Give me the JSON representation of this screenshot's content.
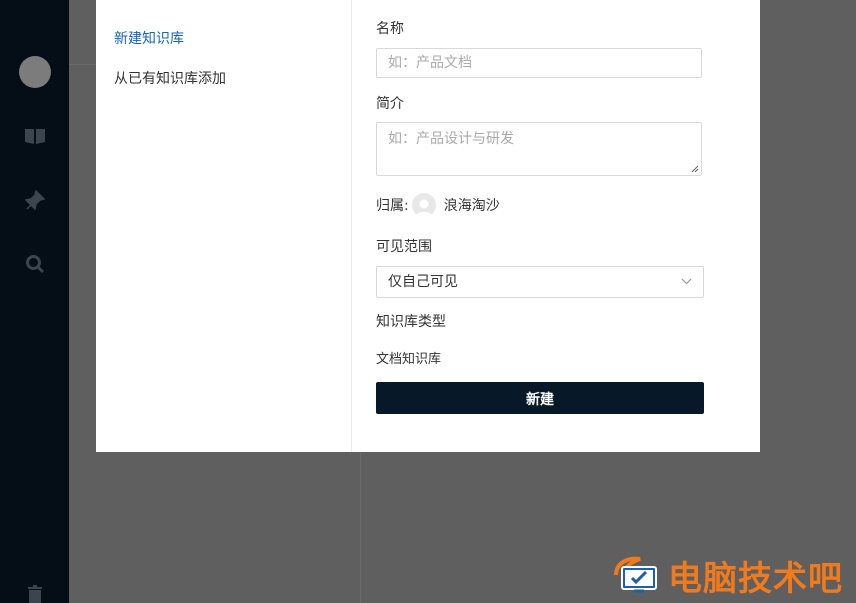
{
  "modal": {
    "nav": [
      {
        "label": "新建知识库",
        "active": true
      },
      {
        "label": "从已有知识库添加",
        "active": false
      }
    ],
    "form": {
      "name_label": "名称",
      "name_placeholder": "如：产品文档",
      "intro_label": "简介",
      "intro_placeholder": "如：产品设计与研发",
      "owner_label": "归属:",
      "owner_name": "浪海淘沙",
      "visibility_label": "可见范围",
      "visibility_value": "仅自己可见",
      "type_label": "知识库类型",
      "type_value": "文档知识库",
      "submit_label": "新建"
    }
  },
  "watermark": {
    "text": "电脑技术吧"
  },
  "colors": {
    "accent": "#1766b5",
    "button": "#071828",
    "watermark": "#f07a1c"
  }
}
